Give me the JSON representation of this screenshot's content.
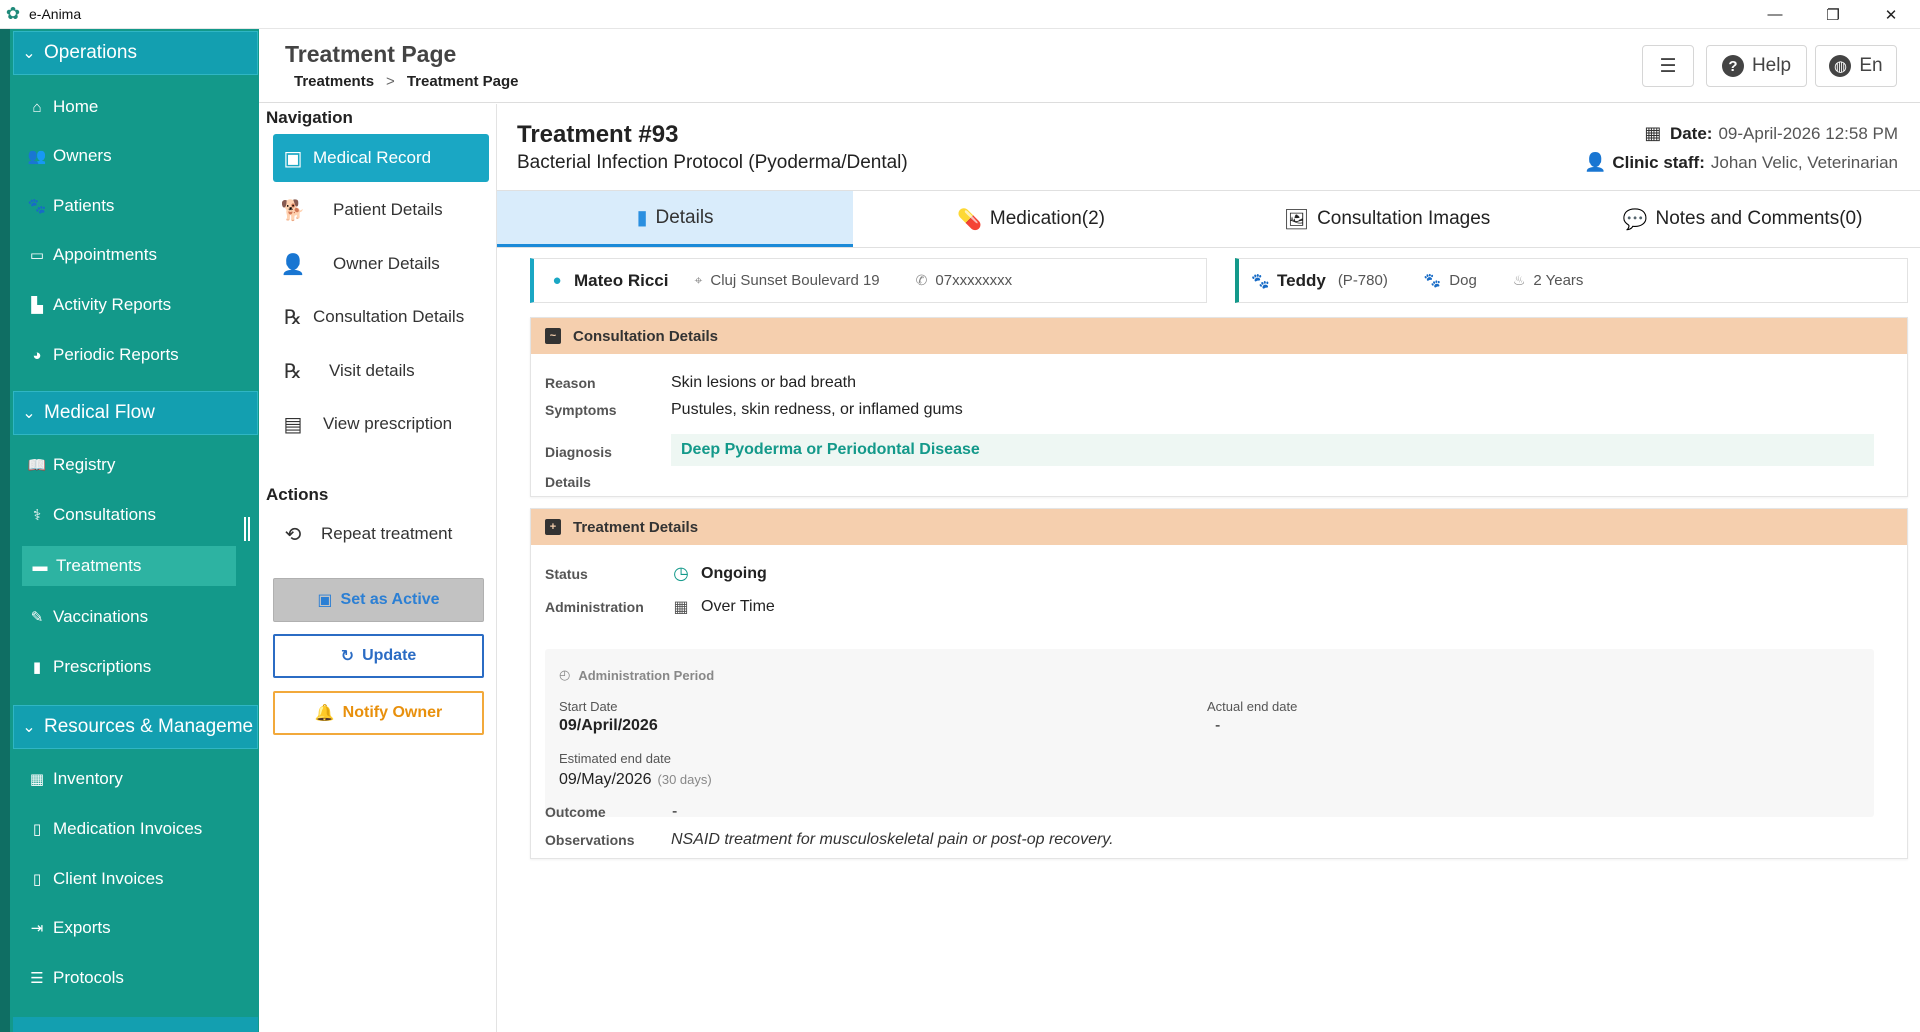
{
  "app": {
    "title": "e-Anima",
    "logo_icon": "paw-icon",
    "window_controls": [
      "—",
      "❐",
      "✕"
    ]
  },
  "sidebar": {
    "sections": [
      {
        "title": "Operations",
        "items": [
          "Home",
          "Owners",
          "Patients",
          "Appointments",
          "Activity Reports",
          "Periodic Reports"
        ]
      },
      {
        "title": "Medical Flow",
        "items": [
          "Registry",
          "Consultations",
          "Treatments",
          "Vaccinations",
          "Prescriptions"
        ]
      },
      {
        "title": "Resources & Manageme",
        "items": [
          "Inventory",
          "Medication Invoices",
          "Client Invoices",
          "Exports",
          "Protocols"
        ]
      }
    ],
    "active_item": "Treatments"
  },
  "header": {
    "title": "Treatment Page",
    "breadcrumb": [
      "Treatments",
      "Treatment Page"
    ],
    "breadcrumb_sep": ">",
    "help_label": "Help",
    "lang_label": "En"
  },
  "navpanel": {
    "navigation_title": "Navigation",
    "items": [
      "Medical Record",
      "Patient Details",
      "Owner Details",
      "Consultation Details",
      "Visit details",
      "View prescription"
    ],
    "actions_title": "Actions",
    "repeat_label": "Repeat treatment",
    "set_active_label": "Set as Active",
    "update_label": "Update",
    "notify_label": "Notify Owner"
  },
  "treatment": {
    "title": "Treatment #93",
    "subtitle": "Bacterial Infection Protocol (Pyoderma/Dental)",
    "date_label": "Date:",
    "date_value": "09-April-2026 12:58 PM",
    "staff_label": "Clinic staff:",
    "staff_value": "Johan Velic, Veterinarian"
  },
  "tabs": [
    "Details",
    "Medication(2)",
    "Consultation Images",
    "Notes and Comments(0)"
  ],
  "owner": {
    "name": "Mateo Ricci",
    "address": "Cluj Sunset Boulevard 19",
    "phone": "07xxxxxxxx"
  },
  "pet": {
    "name": "Teddy",
    "id": "(P-780)",
    "species": "Dog",
    "age": "2 Years"
  },
  "consultation": {
    "heading": "Consultation Details",
    "reason_label": "Reason",
    "reason": "Skin lesions or bad breath",
    "symptoms_label": "Symptoms",
    "symptoms": "Pustules, skin redness, or inflamed gums",
    "diagnosis_label": "Diagnosis",
    "diagnosis": "Deep Pyoderma or Periodontal Disease",
    "details_label": "Details"
  },
  "treatment_details": {
    "heading": "Treatment Details",
    "status_label": "Status",
    "status": "Ongoing",
    "admin_label": "Administration",
    "admin": "Over Time",
    "period_title": "Administration Period",
    "start_label": "Start Date",
    "start": "09/April/2026",
    "actual_end_label": "Actual end date",
    "actual_end": "-",
    "est_end_label": "Estimated end date",
    "est_end": "09/May/2026",
    "est_days": "(30 days)",
    "outcome_label": "Outcome",
    "outcome": "-",
    "observations_label": "Observations",
    "observations": "NSAID treatment for musculoskeletal pain or post-op recovery."
  },
  "colors": {
    "sidebar": "#13998a",
    "accent": "#1aa7c4",
    "panel_header": "#f5cfae",
    "diagnosis": "#13998a"
  }
}
